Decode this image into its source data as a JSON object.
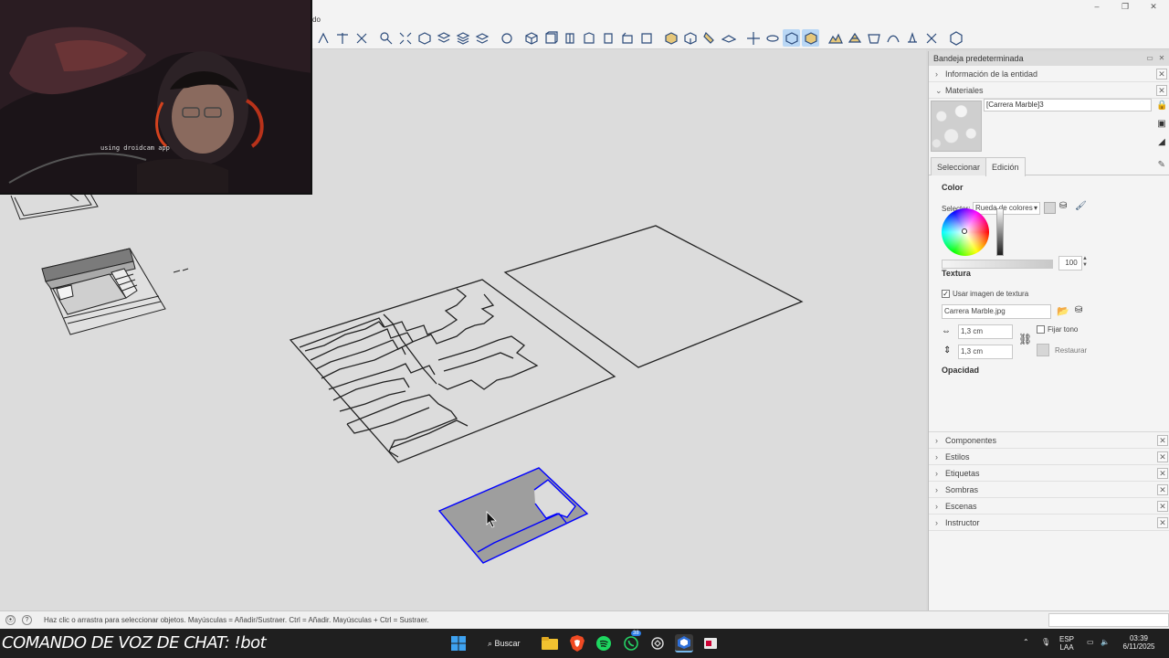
{
  "window": {
    "title_fragment": "do",
    "controls": [
      "–",
      "❐",
      "✕"
    ]
  },
  "webcam": {
    "overlay_text": "using droidcam app"
  },
  "toolbar": {
    "icons": [
      "walk-icon",
      "section-plane-icon",
      "tape-icon",
      "zoom-icon",
      "zoom-extents-icon",
      "iso-view-icon",
      "x-ray-icon",
      "stack-icon",
      "layers-icon",
      "eye-dropdown-icon",
      "cube-iso-icon",
      "front-view-icon",
      "right-view-icon",
      "back-view-icon",
      "left-view-icon",
      "bottom-view-icon",
      "top-view-icon",
      "box-icon",
      "box-open-icon",
      "paint-icon",
      "plane-icon",
      "move-icon",
      "orbit-icon",
      "style-wire-icon",
      "style-shaded-icon",
      "terrain-icon",
      "sandbox-icon",
      "drape-icon",
      "smooth-icon",
      "stamp-icon",
      "flip-icon",
      "extension-icon"
    ],
    "active_icons": [
      "style-wire-icon",
      "style-shaded-icon"
    ]
  },
  "tray": {
    "title": "Bandeja predeterminada",
    "sections": {
      "entity_info": "Información de la entidad",
      "materials": "Materiales"
    },
    "material": {
      "name": "[Carrera Marble]3",
      "tabs": [
        "Seleccionar",
        "Edición"
      ],
      "active_tab": "Edición",
      "color_heading": "Color",
      "selector_label": "Selector:",
      "selector_value": "Rueda de colores",
      "texture_heading": "Textura",
      "use_texture_label": "Usar imagen de textura",
      "use_texture_checked": true,
      "texture_file": "Carrera Marble.jpg",
      "width": "1,3 cm",
      "height": "1,3 cm",
      "fix_tone_label": "Fijar tono",
      "restore_label": "Restaurar",
      "opacity_heading": "Opacidad",
      "opacity_value": "100",
      "opacity_level": 1.0
    },
    "collapsed_sections": [
      "Componentes",
      "Estilos",
      "Etiquetas",
      "Sombras",
      "Escenas",
      "Instructor"
    ]
  },
  "status": {
    "hint": "Haz clic o arrastra para seleccionar objetos. Mayúsculas = Añadir/Sustraer. Ctrl = Añadir. Mayúsculas + Ctrl = Sustraer."
  },
  "taskbar": {
    "chat_command": "COMANDO DE VOZ DE CHAT: !bot",
    "search_label": "Buscar",
    "whatsapp_badge": "38",
    "lang_line1": "ESP",
    "lang_line2": "LAA",
    "time": "03:39",
    "date": "6/11/2025"
  },
  "colors": {
    "selection_blue": "#0000ff",
    "viewport_bg": "#dcdcdc",
    "selected_face": "#9e9e9e"
  }
}
